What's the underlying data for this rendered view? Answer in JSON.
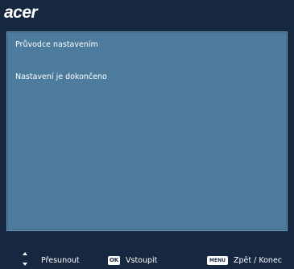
{
  "brand": {
    "logo_text": "acer"
  },
  "panel": {
    "title": "Průvodce nastavením",
    "message": "Nastavení je dokončeno"
  },
  "footer": {
    "move_icons": [
      "arrow-up-icon",
      "arrow-down-icon"
    ],
    "move_label": "Přesunout",
    "ok_key": "OK",
    "enter_label": "Vstoupit",
    "menu_key": "MENU",
    "back_label": "Zpět / Konec"
  },
  "colors": {
    "background": "#16283f",
    "panel": "#4d7b9d",
    "text": "#ffffff"
  }
}
